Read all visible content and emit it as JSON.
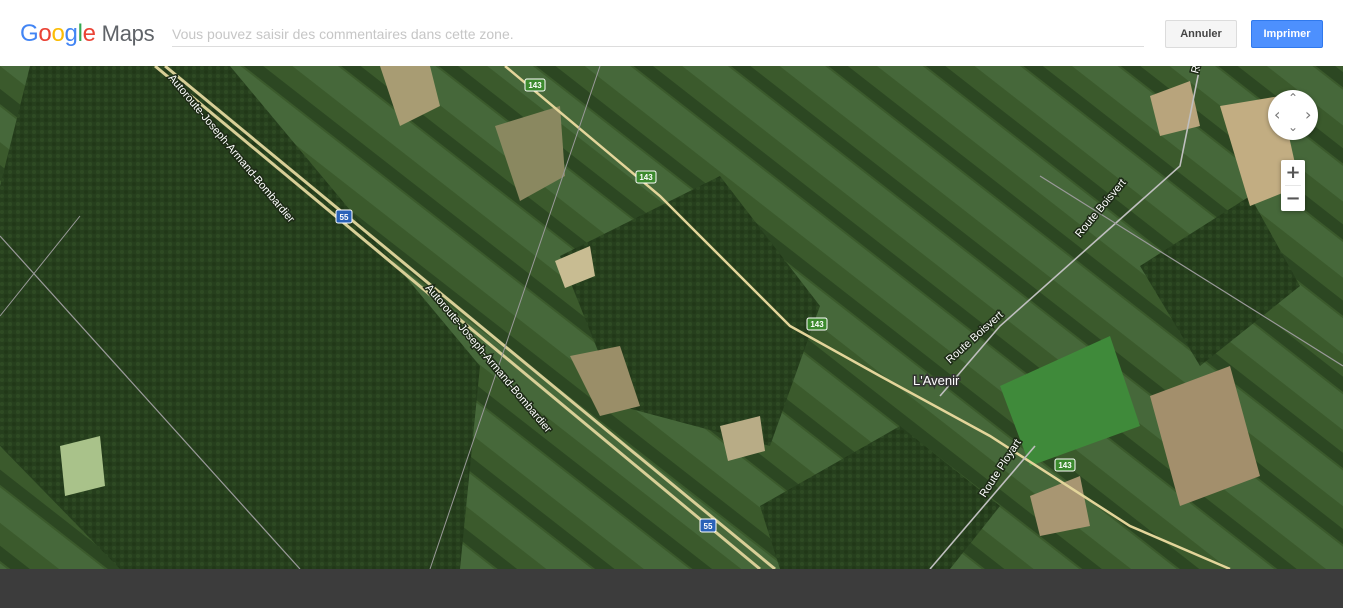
{
  "header": {
    "logo_google": [
      "G",
      "o",
      "o",
      "g",
      "l",
      "e"
    ],
    "logo_maps": "Maps",
    "comment_placeholder": "Vous pouvez saisir des commentaires dans cette zone.",
    "cancel_label": "Annuler",
    "print_label": "Imprimer"
  },
  "map": {
    "map_type": "satellite",
    "labels": {
      "autoroute_1": "Autoroute-Joseph-Armand-Bombardier",
      "autoroute_2": "Autoroute-Joseph-Armand-Bombardier",
      "route_boisvert_1": "Route Boisvert",
      "route_boisvert_2": "Route Boisvert",
      "route_ployart": "Route Ployart",
      "route_top": "Route",
      "town": "L'Avenir"
    },
    "shields": {
      "s143_a": "143",
      "s143_b": "143",
      "s143_c": "143",
      "s143_d": "143",
      "s55_a": "55",
      "s55_b": "55"
    },
    "colors": {
      "shield_143": "#3c8a2e",
      "shield_55": "#2a62b8",
      "road": "#e3d59a"
    }
  },
  "controls": {
    "zoom_in": "+",
    "zoom_out": "−",
    "pan_up": "⌃",
    "pan_down": "⌄",
    "pan_left": "‹",
    "pan_right": "›"
  }
}
